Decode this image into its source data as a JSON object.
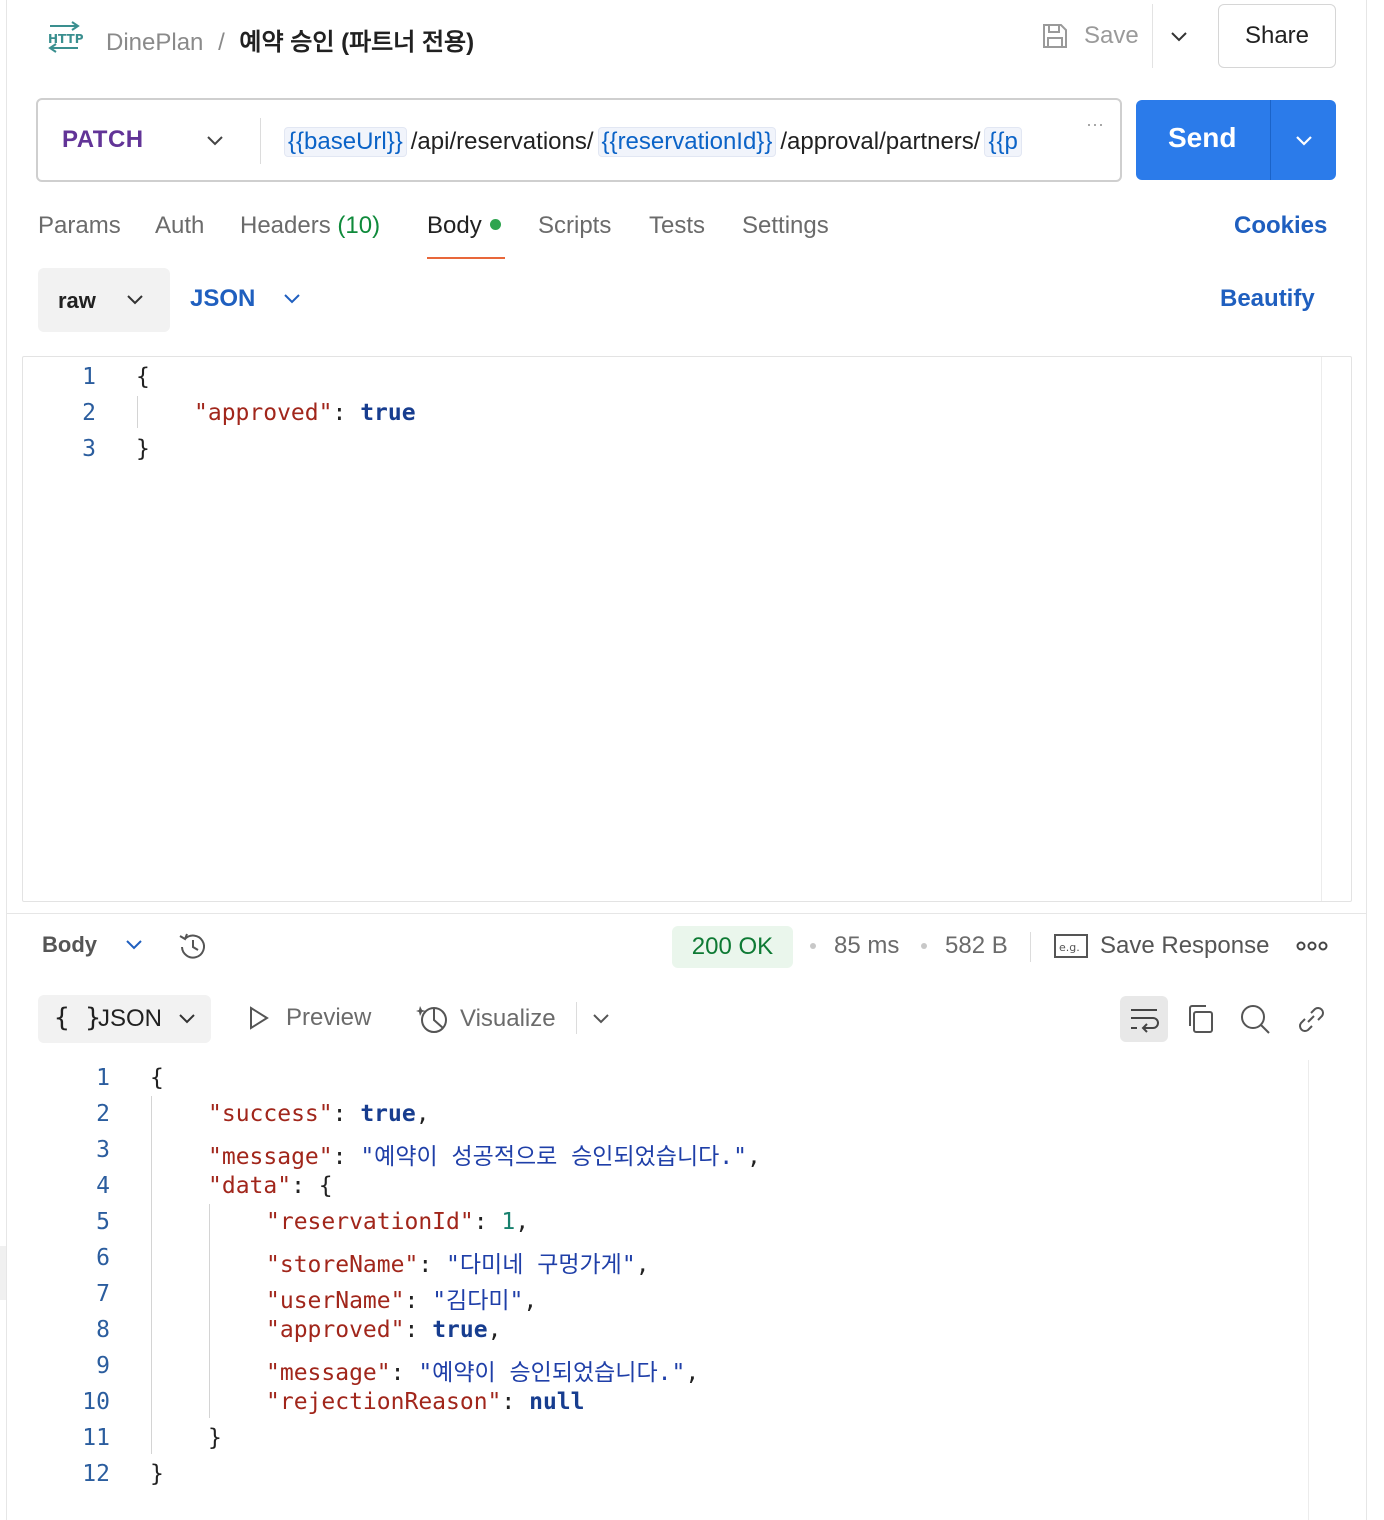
{
  "header": {
    "workspace": "DinePlan",
    "separator": "/",
    "request_name": "예약 승인 (파트너 전용)",
    "save_label": "Save",
    "share_label": "Share"
  },
  "request": {
    "method": "PATCH",
    "url_parts": [
      {
        "type": "var",
        "text": "{{baseUrl}}"
      },
      {
        "type": "text",
        "text": "/api/reservations/"
      },
      {
        "type": "var",
        "text": "{{reservationId}}"
      },
      {
        "type": "text",
        "text": "/approval/partners/"
      },
      {
        "type": "var",
        "text": "{{p"
      }
    ],
    "overflow": "···",
    "send_label": "Send"
  },
  "tabs": {
    "params": "Params",
    "auth": "Auth",
    "headers": "Headers",
    "headers_count": "(10)",
    "body": "Body",
    "scripts": "Scripts",
    "tests": "Tests",
    "settings": "Settings",
    "cookies": "Cookies"
  },
  "body_mode": {
    "mode": "raw",
    "format": "JSON",
    "beautify": "Beautify"
  },
  "request_body": {
    "line_numbers": [
      "1",
      "2",
      "3"
    ],
    "key": "\"approved\"",
    "value": "true"
  },
  "response_bar": {
    "body_label": "Body",
    "status": "200 OK",
    "time": "85 ms",
    "size": "582 B",
    "save_response": "Save Response",
    "status_color": "#0e7a34"
  },
  "response_view": {
    "format": "JSON",
    "format_icon": "{ }",
    "preview": "Preview",
    "visualize": "Visualize"
  },
  "response_body": {
    "line_numbers": [
      "1",
      "2",
      "3",
      "4",
      "5",
      "6",
      "7",
      "8",
      "9",
      "10",
      "11",
      "12"
    ],
    "success_key": "\"success\"",
    "success_val": "true",
    "message_key": "\"message\"",
    "message_val": "\"예약이 성공적으로 승인되었습니다.\"",
    "data_key": "\"data\"",
    "reservationId_key": "\"reservationId\"",
    "reservationId_val": "1",
    "storeName_key": "\"storeName\"",
    "storeName_val": "\"다미네 구멍가게\"",
    "userName_key": "\"userName\"",
    "userName_val": "\"김다미\"",
    "approved_key": "\"approved\"",
    "approved_val": "true",
    "inner_message_key": "\"message\"",
    "inner_message_val": "\"예약이 승인되었습니다.\"",
    "rejection_key": "\"rejectionReason\"",
    "rejection_val": "null"
  },
  "colors": {
    "accent": "#2b7bea",
    "method": "#623497",
    "link": "#1f5fbf",
    "active_tab_underline": "#e8673a",
    "body_dot": "#2ea44f"
  }
}
